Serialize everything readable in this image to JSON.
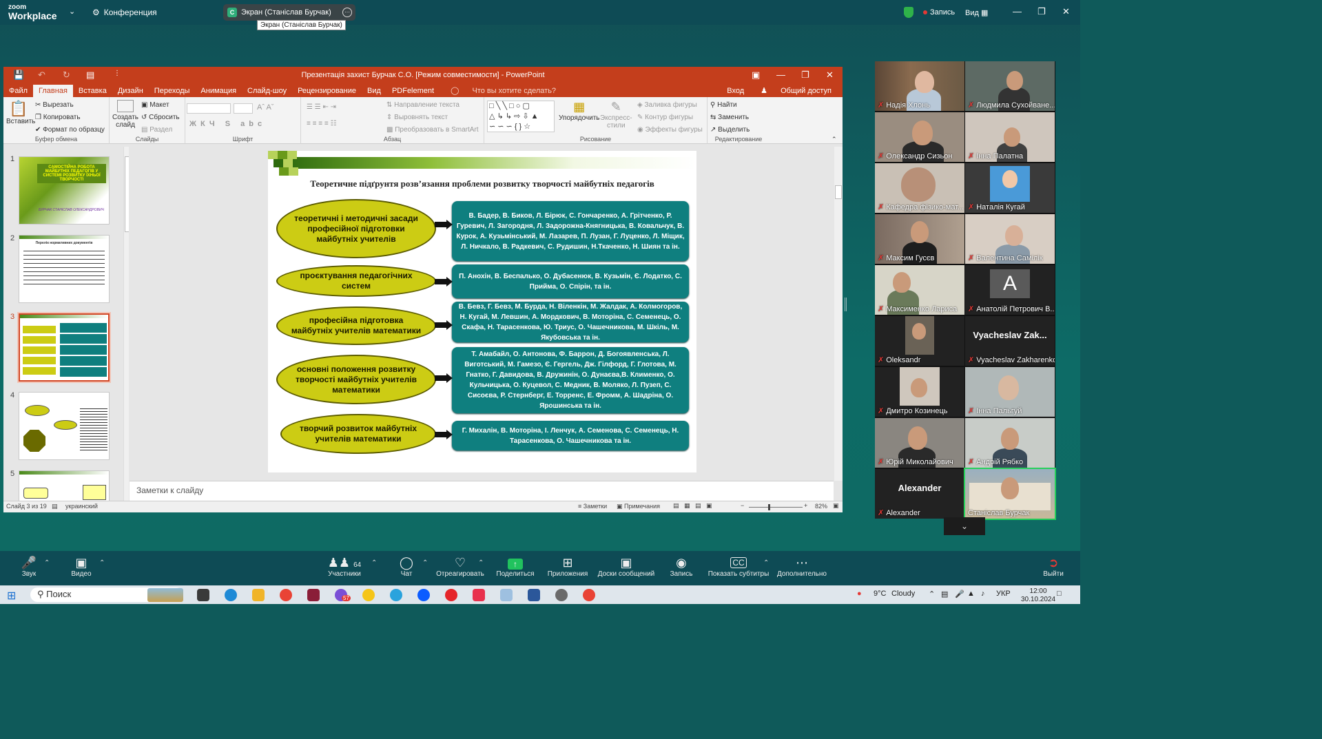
{
  "zoom": {
    "logo_small": "zoom",
    "logo_big": "Workplace",
    "meeting": "Конференция",
    "share_tab": "Экран (Станіслав Бурчак)",
    "share_letter": "С",
    "tooltip": "Экран (Станіслав Бурчак)",
    "record": "Запись",
    "view": "Вид"
  },
  "ppt": {
    "title": "Презентація захист Бурчак С.О. [Режим совместимости] - PowerPoint",
    "tabs": [
      "Файл",
      "Главная",
      "Вставка",
      "Дизайн",
      "Переходы",
      "Анимация",
      "Слайд-шоу",
      "Рецензирование",
      "Вид",
      "PDFelement"
    ],
    "tell_me": "Что вы хотите сделать?",
    "signin": "Вход",
    "share": "Общий доступ",
    "ribbon": {
      "paste": "Вставить",
      "cut": "Вырезать",
      "copy": "Копировать",
      "format_painter": "Формат по образцу",
      "clipboard": "Буфер обмена",
      "new_slide_1": "Создать",
      "new_slide_2": "слайд",
      "layout": "Макет",
      "reset": "Сбросить",
      "section": "Раздел",
      "slides": "Слайды",
      "font": "Шрифт",
      "text_direction": "Направление текста",
      "align_text": "Выровнять текст",
      "smartart": "Преобразовать в SmartArt",
      "paragraph": "Абзац",
      "arrange": "Упорядочить",
      "quick_styles_1": "Экспресс-",
      "quick_styles_2": "стили",
      "shape_fill": "Заливка фигуры",
      "shape_outline": "Контур фигуры",
      "shape_effects": "Эффекты фигуры",
      "drawing": "Рисование",
      "find": "Найти",
      "replace": "Заменить",
      "select": "Выделить",
      "editing": "Редактирование"
    },
    "thumbs": [
      {
        "n": "1",
        "title": "САМОСТІЙНА РОБОТА МАЙБУТНІХ ПЕДАГОГІВ У СИСТЕМІ РОЗВИТКУ ЇХНЬОЇ ТВОРЧОСТІ",
        "author": "БУРЧАК СТАНІСЛАВ ОЛЕКСАНДРОВИЧ"
      },
      {
        "n": "2",
        "title": "Перелік нормативних документів"
      },
      {
        "n": "3"
      },
      {
        "n": "4"
      },
      {
        "n": "5"
      }
    ],
    "notes": "Заметки к слайду",
    "status": {
      "slide": "Слайд 3 из 19",
      "lang": "украинский",
      "notes_btn": "Заметки",
      "comments_btn": "Примечания",
      "zoom": "82%"
    }
  },
  "slide": {
    "title": "Теоретичне підґрунтя розв’язання проблеми розвитку творчості майбутніх педагогів",
    "rows": [
      {
        "topic": "теоретичні і методичні засади професійної підготовки майбутніх учителів",
        "authors": "В. Бадер, В. Биков, Л. Бірюк, С. Гончаренко, А. Грітченко, Р. Гуревич, Л. Загородня, Л. Задорожна-Княгницька, В. Ковальчук, В. Курок, А. Кузьмінський, М. Лазарев, П. Лузан, Г. Луценко, Л. Міщик, Л. Ничкало, В. Радкевич, С. Рудишин, Н.Ткаченко, Н. Шиян та ін."
      },
      {
        "topic": "проєктування педагогічних систем",
        "authors": "П. Анохін, В. Беспалько, О. Дубасенюк, В. Кузьмін, Є. Лодатко, С. Прийма, О. Спірін, та ін."
      },
      {
        "topic": "професійна підготовка майбутніх учителів математики",
        "authors": "В. Бевз, Г. Бевз, М. Бурда, Н. Віленкін, М. Жалдак, А. Колмогоров,  Н. Кугай, М. Левшин, А. Мордкович, В. Моторіна, С. Семенець, О. Скафа, Н. Тарасенкова, Ю. Триус, О. Чашечникова, М. Шкіль, М. Якубовська та ін."
      },
      {
        "topic": "основні положення розвитку творчості майбутніх учителів математики",
        "authors": "Т. Амабайл, О. Антонова, Ф. Баррон, Д. Богоявленська, Л. Виготський, М. Гамезо, Є. Гергель, Дж. Гілфорд, Г. Глотова, М. Гнатко, Г. Давидова, В. Дружинін, О. Дунаєва,В. Клименко, О. Кульчицька, О. Куцевол, С. Медник, В. Моляко, Л. Пузеп, С. Сисоєва, Р. Стернберг, Е. Торренс, Е. Фромм, А. Шадріна, О. Ярошинська та ін."
      },
      {
        "topic": "творчий розвиток майбутніх учителів математики",
        "authors": "Г. Михалін, В. Моторіна, І. Ленчук, А. Семенова, С. Семенець, Н. Тарасенкова, О. Чашечникова та ін."
      }
    ],
    "colors": {
      "ellipse": "#cccc14",
      "box": "#0f7f7f"
    }
  },
  "participants": [
    {
      "name": "Надія Хлонь"
    },
    {
      "name": "Людмила Сухойване..."
    },
    {
      "name": "Олександр Сизьон"
    },
    {
      "name": "Інна Палатна"
    },
    {
      "name": "Кафедра фізико-мат..."
    },
    {
      "name": "Наталія Кугай"
    },
    {
      "name": "Максим Гусєв"
    },
    {
      "name": "Валентина Самілік"
    },
    {
      "name": "Максименко Лариса"
    },
    {
      "name": "Анатолій Петрович В...",
      "avatar": "A"
    },
    {
      "name": "Oleksandr"
    },
    {
      "name": "Vyacheslav Zakharenko",
      "display": "Vyacheslav  Zak..."
    },
    {
      "name": "Дмитро Козинець"
    },
    {
      "name": "Інна Пальгуй"
    },
    {
      "name": "Юрій Миколайович"
    },
    {
      "name": "Андрій Рябко"
    },
    {
      "name": "Alexander",
      "display": "Alexander"
    },
    {
      "name": "Станіслав Бурчак"
    }
  ],
  "toolbar": {
    "audio": "Звук",
    "video": "Видео",
    "participants": "Участники",
    "participants_count": "64",
    "chat": "Чат",
    "react": "Отреагировать",
    "share": "Поделиться",
    "apps": "Приложения",
    "whiteboards": "Доски сообщений",
    "record": "Запись",
    "captions": "Показать субтитры",
    "more": "Дополнительно",
    "leave": "Выйти"
  },
  "taskbar": {
    "search": "Поиск",
    "badge": "57",
    "weather_temp": "9°C",
    "weather_text": "Cloudy",
    "lang": "УКР",
    "time": "12:00",
    "date": "30.10.2024"
  }
}
